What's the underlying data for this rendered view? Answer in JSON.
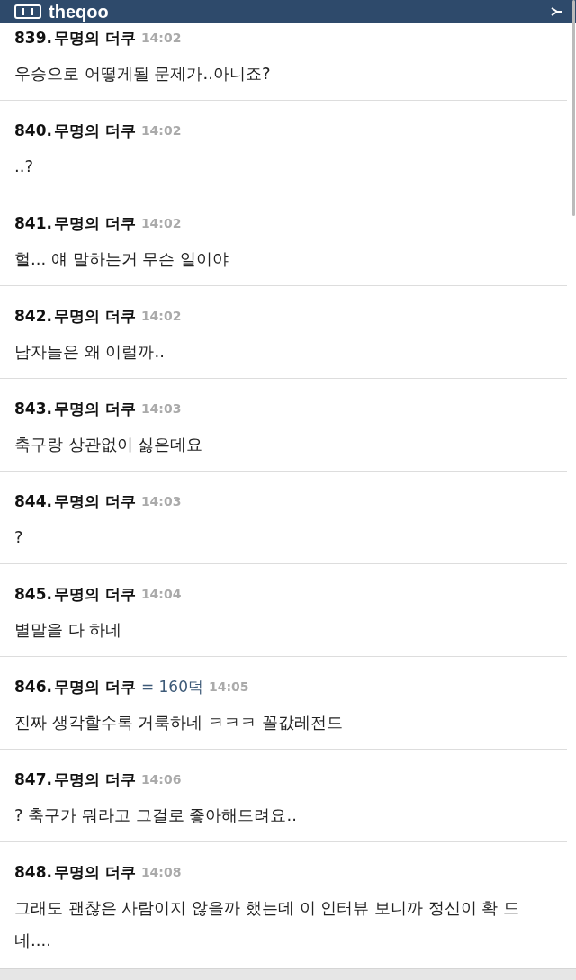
{
  "header": {
    "logo": "theqoo"
  },
  "comments": [
    {
      "number": "839.",
      "author": "무명의 더쿠",
      "time": "14:02",
      "text": "우승으로 어떻게될 문제가..아니죠?"
    },
    {
      "number": "840.",
      "author": "무명의 더쿠",
      "time": "14:02",
      "text": "..?"
    },
    {
      "number": "841.",
      "author": "무명의 더쿠",
      "time": "14:02",
      "text": "헐... 얘 말하는거 무슨 일이야"
    },
    {
      "number": "842.",
      "author": "무명의 더쿠",
      "time": "14:02",
      "text": "남자들은 왜 이럴까.."
    },
    {
      "number": "843.",
      "author": "무명의 더쿠",
      "time": "14:03",
      "text": "축구랑 상관없이 싫은데요"
    },
    {
      "number": "844.",
      "author": "무명의 더쿠",
      "time": "14:03",
      "text": "?"
    },
    {
      "number": "845.",
      "author": "무명의 더쿠",
      "time": "14:04",
      "text": "별말을 다 하네"
    },
    {
      "number": "846.",
      "author": "무명의 더쿠",
      "reply_to": "= 160덕",
      "time": "14:05",
      "text": "진짜 생각할수록 거룩하네 ㅋㅋㅋ 꼴값레전드"
    },
    {
      "number": "847.",
      "author": "무명의 더쿠",
      "time": "14:06",
      "text": "? 축구가 뭐라고 그걸로 좋아해드려요.."
    },
    {
      "number": "848.",
      "author": "무명의 더쿠",
      "time": "14:08",
      "text": "그래도 괜찮은 사람이지 않을까 했는데 이 인터뷰 보니까 정신이 확 드네...."
    }
  ]
}
